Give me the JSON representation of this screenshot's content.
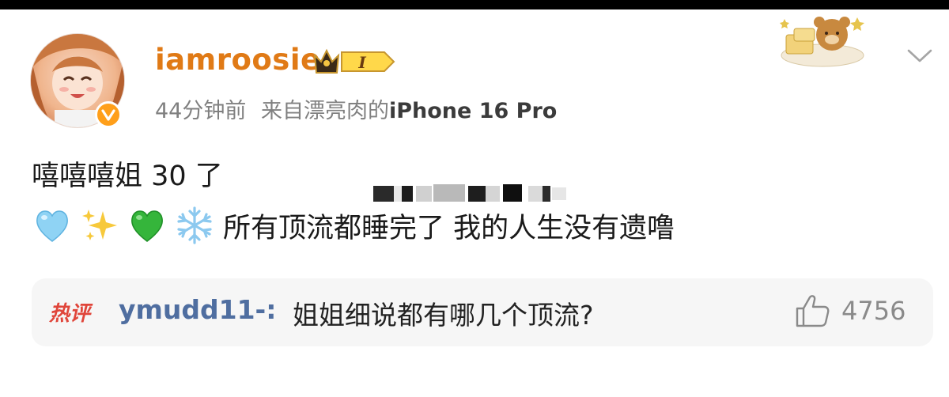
{
  "post": {
    "author": {
      "name": "iamroosie",
      "verified": true,
      "badge_level": "I"
    },
    "time": "44分钟前",
    "source_prefix": "来自漂亮肉的",
    "source_device": "iPhone 16 Pro",
    "line1": "嘻嘻嘻姐 30 了",
    "line2_emojis": [
      "blue-heart",
      "sparkles",
      "green-heart",
      "snowflake"
    ],
    "line2_text": "所有顶流都睡完了 我的人生没有遗噜"
  },
  "hot_comment": {
    "badge": "热评",
    "author": "ymudd11-:",
    "text": "姐姐细说都有哪几个顶流?",
    "likes": "4756"
  },
  "colors": {
    "username": "#e07a16",
    "meta": "#808080",
    "comment_author": "#4f6ea0",
    "hot_badge": "#e0453a",
    "verify_badge": "#ff9f1a"
  }
}
